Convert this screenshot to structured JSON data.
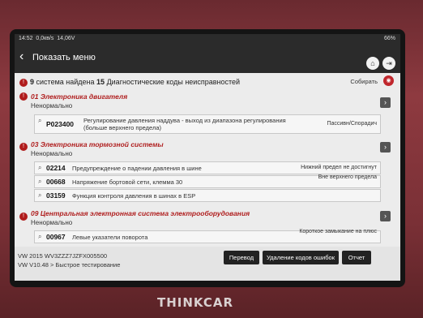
{
  "status_bar": {
    "time": "14:52",
    "net": "0,0кв/s",
    "voltage": "14,06V",
    "battery": "66%"
  },
  "header": {
    "title": "Показать меню",
    "home_icon": "home-icon",
    "exit_icon": "exit-icon"
  },
  "summary": {
    "systems_count": "9",
    "systems_text": "система найдена",
    "codes_count": "15",
    "codes_text": "Диагностические коды неисправностей",
    "collect_label": "Собирать",
    "collect_icon": "camera-icon"
  },
  "systems": [
    {
      "title": "01 Электроника двигателя",
      "status": "Ненормально",
      "codes": [
        {
          "code": "P023400",
          "desc": "Регулирование давления наддува - выход из диапазона регулирования (больше верхнего предела)",
          "state": "Пассивн/Спорадич"
        }
      ]
    },
    {
      "title": "03 Электроника тормозной системы",
      "status": "Ненормально",
      "codes": [
        {
          "code": "02214",
          "desc": "Предупреждение о падении давления в шине",
          "state": "Нижний предел не достигнут"
        },
        {
          "code": "00668",
          "desc": "Напряжение бортовой сети, клемма 30",
          "state": "Вне верхнего предела"
        },
        {
          "code": "03159",
          "desc": "Функция контроля давления в шинах в ESP",
          "state": ""
        }
      ]
    },
    {
      "title": "09 Центральная электронная система электрооборудования",
      "status": "Ненормально",
      "codes": [
        {
          "code": "00967",
          "desc": "Левые указатели поворота",
          "state": "Короткое замыкание на плюс"
        }
      ]
    }
  ],
  "footer": {
    "vin": "VW  2015  WV3ZZZ7JZFX005500",
    "version": "VW V10.48 > Быстрое тестирование",
    "translate_label": "Перевод",
    "clear_label": "Удаление кодов ошибок",
    "report_label": "Отчет"
  },
  "brand": "THINKCAR",
  "colors": {
    "accent": "#b01c1c",
    "header_bg": "#2b2b2b",
    "device": "#8e3a40"
  }
}
